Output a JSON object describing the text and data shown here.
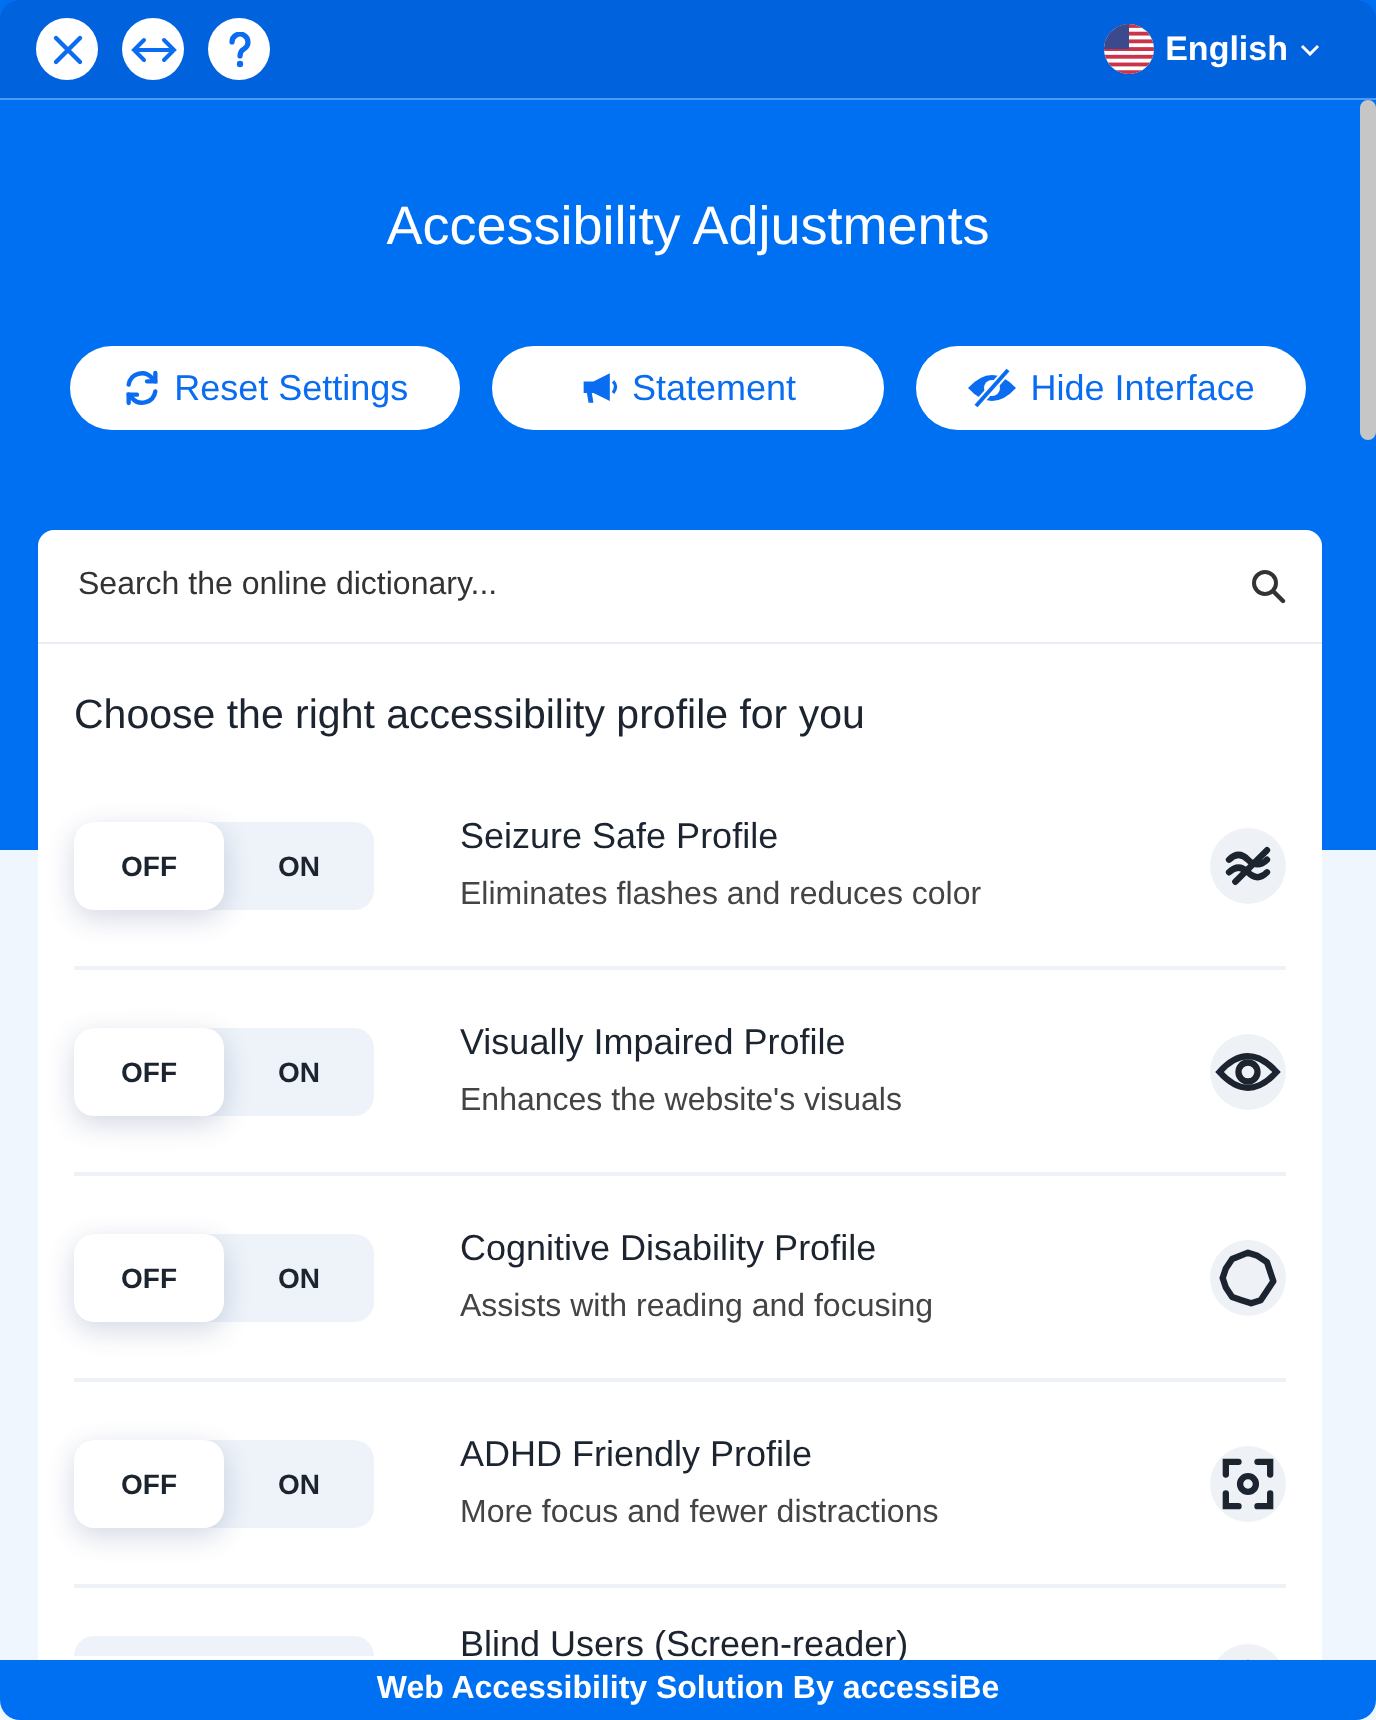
{
  "header": {
    "language": "English"
  },
  "title": "Accessibility Adjustments",
  "actions": [
    {
      "kind": "reset",
      "label": "Reset Settings"
    },
    {
      "kind": "statement",
      "label": "Statement"
    },
    {
      "kind": "hide",
      "label": "Hide Interface"
    }
  ],
  "search": {
    "placeholder": "Search the online dictionary..."
  },
  "profiles_heading": "Choose the right accessibility profile for you",
  "profiles": [
    {
      "kind": "seizure",
      "off_label": "OFF",
      "on_label": "ON",
      "on": false,
      "title": "Seizure Safe Profile",
      "description": "Eliminates flashes and reduces color"
    },
    {
      "kind": "vision",
      "off_label": "OFF",
      "on_label": "ON",
      "on": false,
      "title": "Visually Impaired Profile",
      "description": "Enhances the website's visuals"
    },
    {
      "kind": "cognitive",
      "off_label": "OFF",
      "on_label": "ON",
      "on": false,
      "title": "Cognitive Disability Profile",
      "description": "Assists with reading and focusing"
    },
    {
      "kind": "adhd",
      "off_label": "OFF",
      "on_label": "ON",
      "on": false,
      "title": "ADHD Friendly Profile",
      "description": "More focus and fewer distractions"
    },
    {
      "kind": "blind",
      "title": "Blind Users (Screen-reader)"
    }
  ],
  "footer": "Web Accessibility Solution By accessiBe"
}
